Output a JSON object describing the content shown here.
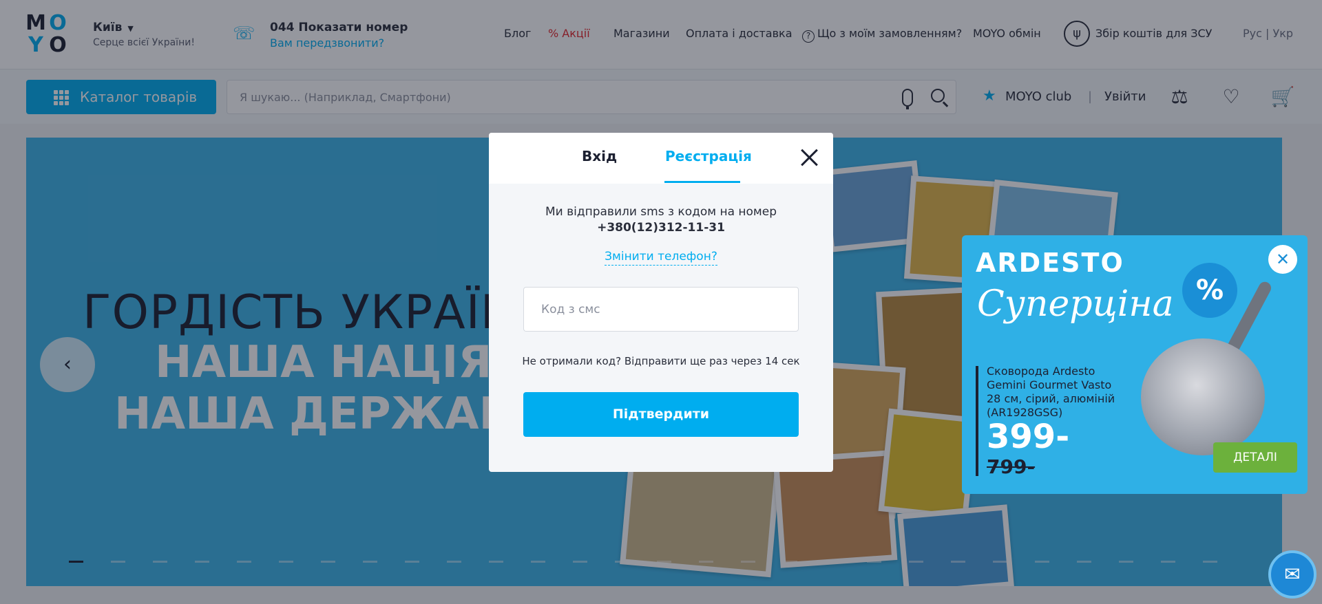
{
  "header": {
    "logo_letters": [
      "M",
      "O",
      "Y",
      "O"
    ],
    "city": "Київ",
    "city_subtitle": "Серце всієї України!",
    "phone": "044 Показати номер",
    "callback": "Вам передзвонити?",
    "nav": {
      "blog": "Блог",
      "sales": "Акції",
      "stores": "Магазини",
      "payment": "Оплата і доставка",
      "order_status": "Що з моїм замовленням?",
      "exchange": "MOYO обмін",
      "fundraising": "Збір коштів для ЗСУ"
    },
    "langs": "Рус | Укр"
  },
  "searchbar": {
    "catalog_label": "Каталог товарів",
    "search_placeholder": "Я шукаю... (Наприклад, Смартфони)",
    "club_label": "MOYO club",
    "separator": "|",
    "login_label": "Увійти"
  },
  "banner": {
    "line1": "ГОРДІСТЬ УКРАЇНЦ",
    "line2": "НАША НАЦІЯ,",
    "line3": "НАША ДЕРЖАВА"
  },
  "modal": {
    "tab_login": "Вхід",
    "tab_register": "Реєстрація",
    "sms_message": "Ми відправили sms з кодом на номер",
    "phone_number": "+380(12)312-11-31",
    "change_phone": "Змінити телефон?",
    "code_placeholder": "Код з смс",
    "resend_text": "Не отримали код? Відправити ще раз через 14 сек",
    "confirm_label": "Підтвердити"
  },
  "promo": {
    "brand": "ARDESTO",
    "script_text": "Суперціна",
    "product_name": "Сковорода Ardesto Gemini Gourmet Vasto 28 см, сірий, алюміній (AR1928GSG)",
    "price": "399-",
    "old_price": "799-",
    "details_label": "ДЕТАЛІ",
    "percent": "%"
  },
  "icons": {
    "accent_color": "#00adef",
    "sale_color": "#e3262b"
  }
}
